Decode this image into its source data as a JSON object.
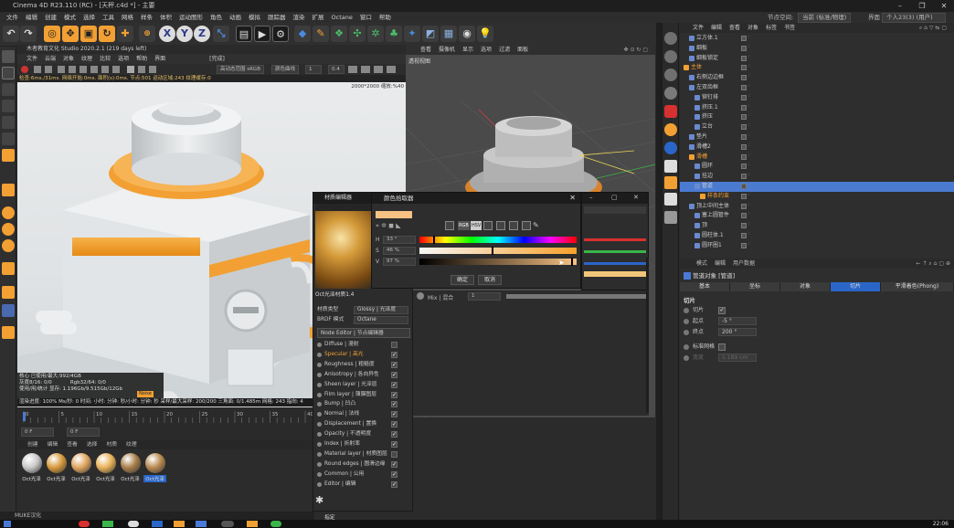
{
  "window": {
    "title": "Cinema 4D R23.110 (RC) - [天秤.c4d *] - 主要",
    "min": "–",
    "max": "❐",
    "close": "✕"
  },
  "menubar": {
    "items": [
      "文件",
      "编辑",
      "创建",
      "模式",
      "选择",
      "工具",
      "网格",
      "样条",
      "体积",
      "运动图形",
      "角色",
      "动画",
      "模拟",
      "跟踪器",
      "渲染",
      "扩展",
      "Octane",
      "窗口",
      "帮助"
    ],
    "node_space_label": "节点空间:",
    "node_space_value": "当前 (标准/物理)",
    "layout_label": "界面",
    "layout_value": "个人23(3) (用户)"
  },
  "colors": {
    "orange": "#f2a033",
    "accent_blue": "#2a66c8",
    "red": "#d73030",
    "selection": "#4b7bd1"
  },
  "toolbar": {
    "icons": [
      "undo-icon",
      "redo-icon",
      "select-icon",
      "move-icon",
      "scale-icon",
      "rotate-icon",
      "add-icon",
      "x-axis-icon",
      "y-axis-icon",
      "z-axis-icon",
      "coordinate-icon",
      "render-region-icon",
      "render-view-icon",
      "render-settings-icon",
      "cube-icon",
      "pen-icon",
      "subdivision-icon",
      "cloner-icon",
      "deformer-icon",
      "scene-icon",
      "camera-icon",
      "light-icon"
    ],
    "axes": [
      "X",
      "Y",
      "Z"
    ]
  },
  "render_window": {
    "title": "木者教育文化 Studio 2020.2.1 (219 days left)",
    "menu": [
      "文件",
      "云端",
      "对象",
      "纹理",
      "比较",
      "选项",
      "帮助",
      "界面"
    ],
    "status_right": "[完成]",
    "stats": "检查:6ms./31ms. 网络开始:0ms. 面积(s):0ms. 节点:501 运动区域:243 纹理缓存:0",
    "resolution": "2000*2000 缩放:%40",
    "color_mode": "高动态范围 sRGB",
    "tonemap": "颜色曲线",
    "zoom_value": "1",
    "exposure_value": "0.4"
  },
  "render_info": {
    "line1": "核心 已使用/最大:992/4GB",
    "line2": "灰度8/16: 0/0",
    "line3": "Rgb32/64: 0/0",
    "line4": "使用/用/统计 显存: 1.196Gb/9.515Gb/12Gb"
  },
  "render_status": "渲染进度: 100%  Ms/秒: 0  时间: 小时: 分钟: 秒/小时: 分钟: 秒  采样/最大采样: 200/200  三角面: 0/1.485m  网格: 243  指向: 4",
  "noise_label": "Noise",
  "timeline": {
    "ticks": [
      "0",
      "5",
      "10",
      "15",
      "20",
      "25",
      "30",
      "35",
      "40"
    ],
    "frame_start": "0 F",
    "frame_current": "0 F"
  },
  "material_manager": {
    "menu": [
      "创建",
      "编辑",
      "查看",
      "选择",
      "材质",
      "纹理"
    ],
    "materials": [
      "Oct光泽",
      "Oct光泽",
      "Oct光泽",
      "Oct光泽",
      "Oct光泽",
      "Oct光泽"
    ],
    "colors": [
      "#c9c9c9",
      "#d79a3c",
      "#e0a560",
      "#e8b25a",
      "#a87e4a",
      "#b88a50"
    ]
  },
  "status": {
    "text": "MUKE汉化"
  },
  "viewport": {
    "menu": [
      "查看",
      "摄像机",
      "显示",
      "选项",
      "过滤",
      "面板"
    ],
    "label": "透视视图"
  },
  "picker": {
    "title": "颜色拾取器",
    "h_label": "H",
    "h_value": "33 °",
    "s_label": "S",
    "s_value": "46 %",
    "v_label": "V",
    "v_value": "97 %",
    "mode_rgb": "RGB",
    "mode_hsv": "HSV",
    "ok": "确定",
    "cancel": "取消",
    "swatch_color": "#f7c184"
  },
  "material_editor": {
    "title": "材质编辑器",
    "material_name": "Oct光泽材质1.4",
    "type_label": "材质类型",
    "type_value": "Glossy | 光泽度",
    "brdf_label": "BRDF 模式",
    "brdf_value": "Octane",
    "node_editor": "Node Editor | 节点编辑器",
    "channels": [
      {
        "label": "Diffuse | 漫射",
        "checked": false
      },
      {
        "label": "Specular | 高光",
        "checked": true,
        "active": true
      },
      {
        "label": "Roughness | 粗糙度",
        "checked": true
      },
      {
        "label": "Anisotropy | 各向异性",
        "checked": true
      },
      {
        "label": "Sheen layer | 光泽层",
        "checked": true
      },
      {
        "label": "Film layer | 薄膜图层",
        "checked": true
      },
      {
        "label": "Bump | 凹凸",
        "checked": true
      },
      {
        "label": "Normal | 法线",
        "checked": true
      },
      {
        "label": "Displacement | 置换",
        "checked": true
      },
      {
        "label": "Opacity | 不透明度",
        "checked": true
      },
      {
        "label": "Index | 折射率",
        "checked": true
      },
      {
        "label": "Material layer | 材质图层",
        "checked": false
      },
      {
        "label": "Round edges | 圆滑边缘",
        "checked": true
      },
      {
        "label": "Common | 公用",
        "checked": true
      },
      {
        "label": "Editor | 编辑",
        "checked": true
      }
    ],
    "footer": "指定"
  },
  "mix_panel": {
    "label": "Mix | 混合",
    "value": "1"
  },
  "object_manager": {
    "menu": [
      "文件",
      "编辑",
      "查看",
      "对象",
      "标签",
      "书签"
    ],
    "rows": [
      {
        "name": "立方体.1",
        "indent": 1
      },
      {
        "name": "细板",
        "indent": 1
      },
      {
        "name": "细板锁定",
        "indent": 1
      },
      {
        "name": "主体",
        "indent": 0,
        "orange": true
      },
      {
        "name": "右侧边边框",
        "indent": 1
      },
      {
        "name": "左双齿框",
        "indent": 1
      },
      {
        "name": "铆钉排",
        "indent": 2
      },
      {
        "name": "挤压.1",
        "indent": 2
      },
      {
        "name": "挤压",
        "indent": 2
      },
      {
        "name": "立台",
        "indent": 2
      },
      {
        "name": "垫片",
        "indent": 1
      },
      {
        "name": "滑槽2",
        "indent": 1
      },
      {
        "name": "滑槽",
        "indent": 1,
        "orange": true
      },
      {
        "name": "圆环",
        "indent": 2
      },
      {
        "name": "挂边",
        "indent": 2
      },
      {
        "name": "管道",
        "indent": 2,
        "selected": true
      },
      {
        "name": "样条约束",
        "indent": 3,
        "orange": true
      },
      {
        "name": "顶上中间主体",
        "indent": 1
      },
      {
        "name": "塞上圆管件",
        "indent": 2
      },
      {
        "name": "顶",
        "indent": 2
      },
      {
        "name": "圆柱体.1",
        "indent": 2
      },
      {
        "name": "圆环圈1",
        "indent": 2
      }
    ]
  },
  "attribute_manager": {
    "menu": [
      "模式",
      "编辑",
      "用户数据"
    ],
    "object_label": "管道对象 [管道]",
    "tabs": [
      "基本",
      "坐标",
      "对象",
      "切片",
      "平滑着色(Phong)"
    ],
    "active_tab": "切片",
    "section": "切片",
    "fields": [
      {
        "label": "切片",
        "value": "✓"
      },
      {
        "label": "起点",
        "value": "-5 °"
      },
      {
        "label": "终点",
        "value": "200 °"
      },
      {
        "label": "标准网格",
        "value": ""
      },
      {
        "label": "宽度",
        "value": "1.189 cm"
      }
    ]
  },
  "taskbar": {
    "time": "22:06"
  }
}
